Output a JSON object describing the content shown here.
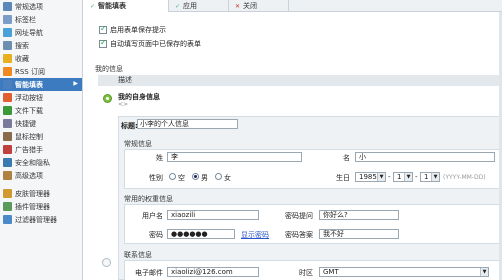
{
  "sidebar": {
    "items": [
      {
        "label": "常规选项",
        "color": "#5b88b8"
      },
      {
        "label": "标签栏",
        "color": "#7a9cc6"
      },
      {
        "label": "网址导航",
        "color": "#4aa0d8"
      },
      {
        "label": "搜索",
        "color": "#6c8fb0"
      },
      {
        "label": "收藏",
        "color": "#e8b020"
      },
      {
        "label": "RSS 订阅",
        "color": "#f08a20"
      },
      {
        "label": "智能填表",
        "color": "#4a7fc0"
      },
      {
        "label": "浮动按钮",
        "color": "#e06030"
      },
      {
        "label": "文件下载",
        "color": "#3a9a3a"
      },
      {
        "label": "快捷键",
        "color": "#7a7a9a"
      },
      {
        "label": "鼠标控制",
        "color": "#8a6a4a"
      },
      {
        "label": "广告猎手",
        "color": "#c04040"
      },
      {
        "label": "安全和隐私",
        "color": "#3a7ab0"
      },
      {
        "label": "高级选项",
        "color": "#b08040"
      },
      {
        "label": "皮肤管理器",
        "color": "#d09a30"
      },
      {
        "label": "插件管理器",
        "color": "#5a9a5a"
      },
      {
        "label": "过滤器管理器",
        "color": "#4a8ac8"
      }
    ],
    "active_index": 6
  },
  "tabs": [
    {
      "label": "智能填表",
      "mark": "✓"
    },
    {
      "label": "应用",
      "mark": "✓"
    },
    {
      "label": "关闭",
      "mark": "✕"
    }
  ],
  "options": {
    "enable_save": "启用表单保存提示",
    "auto_fill": "自动填写页面中已保存的表单"
  },
  "section": {
    "title": "我的信息",
    "desc_header": "描述"
  },
  "profile": {
    "name": "我的自身信息",
    "sub": "<>"
  },
  "detail": {
    "title_label": "标题:",
    "title_value": "小李的个人信息",
    "basic": {
      "header": "常规信息",
      "surname_label": "姓",
      "surname_value": "李",
      "given_label": "名",
      "given_value": "小",
      "gender_label": "性别",
      "gender_options": [
        "空",
        "男",
        "女"
      ],
      "gender_selected": 1,
      "birthday_label": "生日",
      "year": "1985",
      "month": "1",
      "day": "1",
      "date_hint": "(YYYY-MM-DD)"
    },
    "account": {
      "header": "常用的权重信息",
      "username_label": "用户名",
      "username_value": "xiaozili",
      "pwd_question_label": "密码提问",
      "pwd_question_value": "你好么?",
      "password_label": "密码",
      "password_value": "●●●●●●",
      "show_password": "显示密码",
      "pwd_answer_label": "密码答案",
      "pwd_answer_value": "我不好"
    },
    "contact": {
      "header": "联系信息",
      "email_label": "电子邮件",
      "email_value": "xiaolizi@126.com",
      "timezone_label": "时区",
      "timezone_value": "GMT"
    }
  }
}
